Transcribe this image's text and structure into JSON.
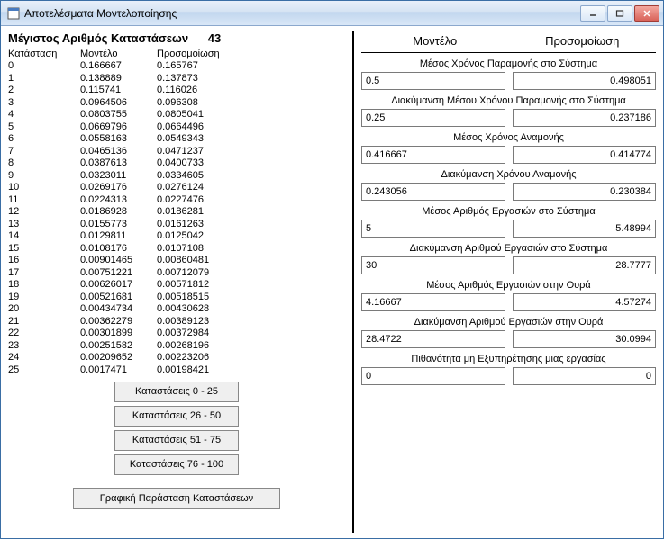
{
  "window": {
    "title": "Αποτελέσματα Μοντελοποίησης"
  },
  "left": {
    "heading": "Μέγιστος Αριθμός Καταστάσεων",
    "heading_value": "43",
    "col_state": "Κατάσταση",
    "col_model": "Μοντέλο",
    "col_sim": "Προσομοίωση",
    "rows": [
      {
        "s": "0",
        "m": "0.166667",
        "p": "0.165767"
      },
      {
        "s": "1",
        "m": "0.138889",
        "p": "0.137873"
      },
      {
        "s": "2",
        "m": "0.115741",
        "p": "0.116026"
      },
      {
        "s": "3",
        "m": "0.0964506",
        "p": "0.096308"
      },
      {
        "s": "4",
        "m": "0.0803755",
        "p": "0.0805041"
      },
      {
        "s": "5",
        "m": "0.0669796",
        "p": "0.0664496"
      },
      {
        "s": "6",
        "m": "0.0558163",
        "p": "0.0549343"
      },
      {
        "s": "7",
        "m": "0.0465136",
        "p": "0.0471237"
      },
      {
        "s": "8",
        "m": "0.0387613",
        "p": "0.0400733"
      },
      {
        "s": "9",
        "m": "0.0323011",
        "p": "0.0334605"
      },
      {
        "s": "10",
        "m": "0.0269176",
        "p": "0.0276124"
      },
      {
        "s": "11",
        "m": "0.0224313",
        "p": "0.0227476"
      },
      {
        "s": "12",
        "m": "0.0186928",
        "p": "0.0186281"
      },
      {
        "s": "13",
        "m": "0.0155773",
        "p": "0.0161263"
      },
      {
        "s": "14",
        "m": "0.0129811",
        "p": "0.0125042"
      },
      {
        "s": "15",
        "m": "0.0108176",
        "p": "0.0107108"
      },
      {
        "s": "16",
        "m": "0.00901465",
        "p": "0.00860481"
      },
      {
        "s": "17",
        "m": "0.00751221",
        "p": "0.00712079"
      },
      {
        "s": "18",
        "m": "0.00626017",
        "p": "0.00571812"
      },
      {
        "s": "19",
        "m": "0.00521681",
        "p": "0.00518515"
      },
      {
        "s": "20",
        "m": "0.00434734",
        "p": "0.00430628"
      },
      {
        "s": "21",
        "m": "0.00362279",
        "p": "0.00389123"
      },
      {
        "s": "22",
        "m": "0.00301899",
        "p": "0.00372984"
      },
      {
        "s": "23",
        "m": "0.00251582",
        "p": "0.00268196"
      },
      {
        "s": "24",
        "m": "0.00209652",
        "p": "0.00223206"
      },
      {
        "s": "25",
        "m": "0.0017471",
        "p": "0.00198421"
      }
    ],
    "btn_0_25": "Καταστάσεις 0 - 25",
    "btn_26_50": "Καταστάσεις 26 - 50",
    "btn_51_75": "Καταστάσεις 51 - 75",
    "btn_76_100": "Καταστάσεις 76 - 100",
    "btn_chart": "Γραφική Παράσταση Καταστάσεων"
  },
  "right": {
    "header_model": "Μοντέλο",
    "header_sim": "Προσομοίωση",
    "metrics": [
      {
        "label": "Μέσος Χρόνος Παραμονής στο Σύστημα",
        "m": "0.5",
        "p": "0.498051"
      },
      {
        "label": "Διακύμανση Μέσου Χρόνου Παραμονής στο Σύστημα",
        "m": "0.25",
        "p": "0.237186"
      },
      {
        "label": "Μέσος Χρόνος Αναμονής",
        "m": "0.416667",
        "p": "0.414774"
      },
      {
        "label": "Διακύμανση Χρόνου Αναμονής",
        "m": "0.243056",
        "p": "0.230384"
      },
      {
        "label": "Μέσος Αριθμός Εργασιών στο Σύστημα",
        "m": "5",
        "p": "5.48994"
      },
      {
        "label": "Διακύμανση Αριθμού Εργασιών στο Σύστημα",
        "m": "30",
        "p": "28.7777"
      },
      {
        "label": "Μέσος Αριθμός Εργασιών στην Ουρά",
        "m": "4.16667",
        "p": "4.57274"
      },
      {
        "label": "Διακύμανση Αριθμού Εργασιών στην Ουρά",
        "m": "28.4722",
        "p": "30.0994"
      },
      {
        "label": "Πιθανότητα μη Εξυπηρέτησης μιας εργασίας",
        "m": "0",
        "p": "0"
      }
    ]
  }
}
